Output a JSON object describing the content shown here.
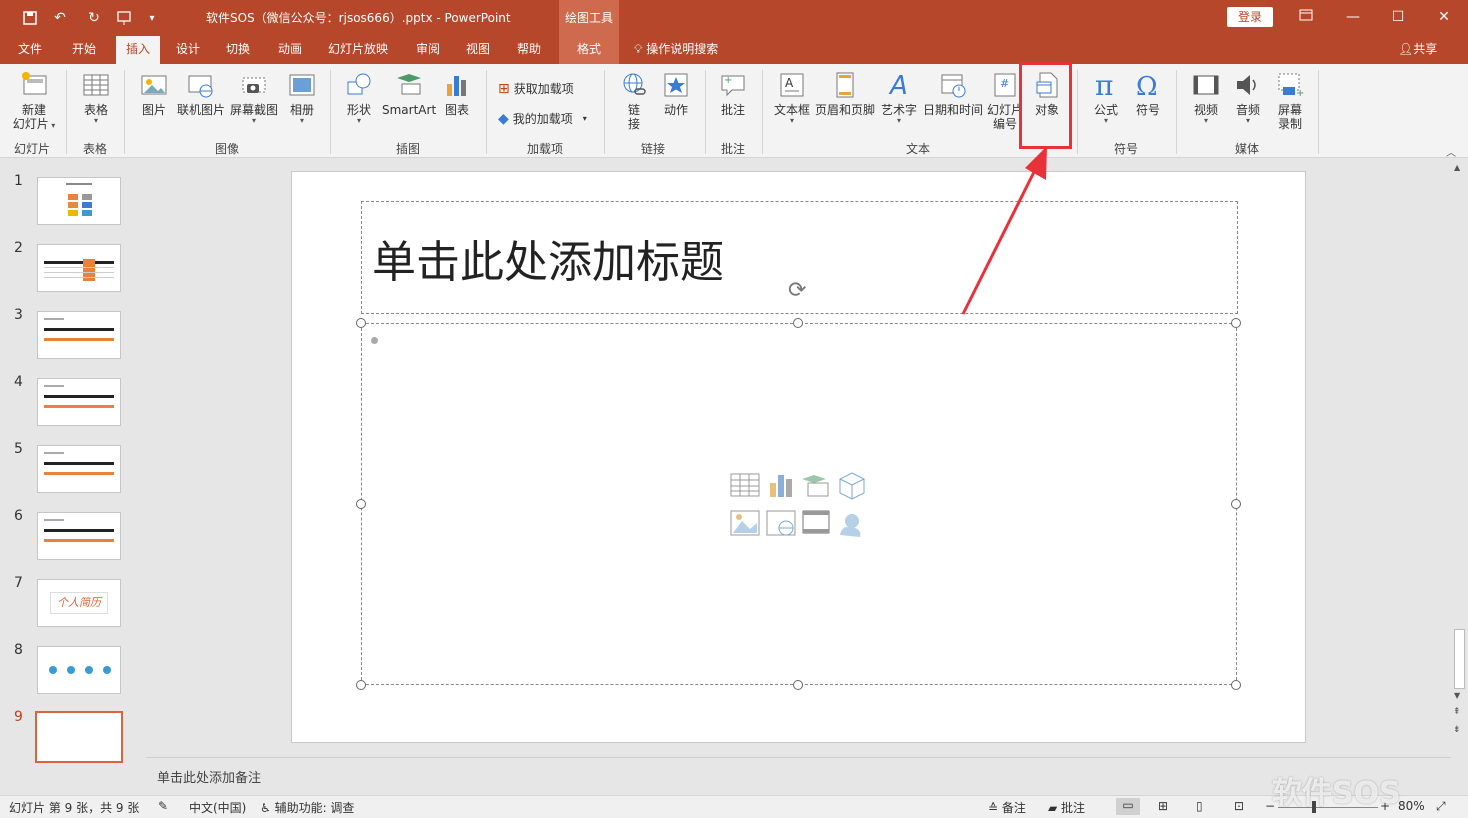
{
  "titlebar": {
    "doc_title": "软件SOS（微信公众号：rjsos666）.pptx  -  PowerPoint",
    "tools_header": "绘图工具",
    "login": "登录"
  },
  "tabs": [
    "文件",
    "开始",
    "插入",
    "设计",
    "切换",
    "动画",
    "幻灯片放映",
    "审阅",
    "视图",
    "帮助"
  ],
  "tab_format": "格式",
  "tellme": "操作说明搜索",
  "share": "共享",
  "ribbon": {
    "new_slide": [
      "新建",
      "幻灯片"
    ],
    "table": "表格",
    "picture": "图片",
    "online_picture": "联机图片",
    "screenshot": "屏幕截图",
    "album": "相册",
    "shapes": "形状",
    "smartart": "SmartArt",
    "chart": "图表",
    "get_addins": "获取加载项",
    "my_addins": "我的加载项",
    "link": [
      "链",
      "接"
    ],
    "action": "动作",
    "comment": "批注",
    "textbox": "文本框",
    "header_footer": "页眉和页脚",
    "wordart": "艺术字",
    "datetime": "日期和时间",
    "slide_number": [
      "幻灯片",
      "编号"
    ],
    "object": "对象",
    "equation": "公式",
    "symbol": "符号",
    "video": "视频",
    "audio": "音频",
    "screen_record": [
      "屏幕",
      "录制"
    ],
    "groups": {
      "slides": "幻灯片",
      "tables": "表格",
      "images": "图像",
      "illustrations": "插图",
      "addins": "加载项",
      "links": "链接",
      "comments": "批注",
      "text": "文本",
      "symbols": "符号",
      "media": "媒体"
    }
  },
  "slides": [
    "1",
    "2",
    "3",
    "4",
    "5",
    "6",
    "7",
    "8",
    "9"
  ],
  "slide7_text": "个人简历",
  "slide_title": "单击此处添加标题",
  "notes": "单击此处添加备注",
  "status": {
    "slide_info": "幻灯片 第 9 张，共 9 张",
    "language": "中文(中国)",
    "accessibility": "辅助功能: 调查",
    "notes": "备注",
    "comments": "批注",
    "zoom": "80%"
  },
  "watermark": "软件SOS",
  "colors": {
    "accent": "#b7472a",
    "highlight": "#e8323a"
  }
}
